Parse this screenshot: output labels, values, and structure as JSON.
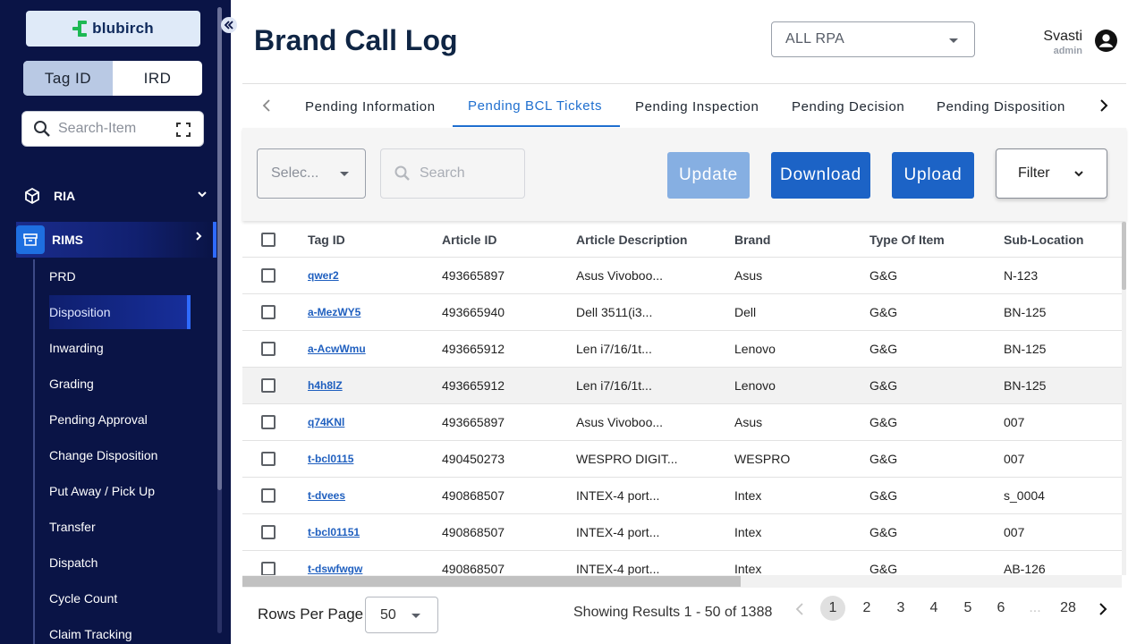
{
  "app": {
    "logo_text": "blubirch"
  },
  "sidebar": {
    "toggle": {
      "left": "Tag ID",
      "right": "IRD"
    },
    "search_placeholder": "Search-Item",
    "modules": [
      {
        "label": "RIA"
      },
      {
        "label": "RIMS"
      }
    ],
    "rims_items": [
      "PRD",
      "Disposition",
      "Inwarding",
      "Grading",
      "Pending Approval",
      "Change Disposition",
      "Put Away / Pick Up",
      "Transfer",
      "Dispatch",
      "Cycle Count",
      "Claim Tracking"
    ],
    "active_item": "Disposition"
  },
  "header": {
    "title": "Brand Call Log",
    "rpa_select": "ALL RPA",
    "user_name": "Svasti",
    "user_role": "admin"
  },
  "tabs": [
    "Pending Information",
    "Pending BCL Tickets",
    "Pending Inspection",
    "Pending Decision",
    "Pending Disposition"
  ],
  "active_tab": "Pending BCL Tickets",
  "toolbar": {
    "select_placeholder": "Selec...",
    "search_placeholder": "Search",
    "update_label": "Update",
    "download_label": "Download",
    "upload_label": "Upload",
    "filter_label": "Filter"
  },
  "table": {
    "columns": [
      "Tag ID",
      "Article ID",
      "Article Description",
      "Brand",
      "Type Of Item",
      "Sub-Location"
    ],
    "rows": [
      [
        "qwer2",
        "493665897",
        "Asus Vivoboo...",
        "Asus",
        "G&G",
        "N-123"
      ],
      [
        "a-MezWY5",
        "493665940",
        "Dell 3511(i3...",
        "Dell",
        "G&G",
        "BN-125"
      ],
      [
        "a-AcwWmu",
        "493665912",
        "Len i7/16/1t...",
        "Lenovo",
        "G&G",
        "BN-125"
      ],
      [
        "h4h8lZ",
        "493665912",
        "Len i7/16/1t...",
        "Lenovo",
        "G&G",
        "BN-125"
      ],
      [
        "q74KNl",
        "493665897",
        "Asus Vivoboo...",
        "Asus",
        "G&G",
        "007"
      ],
      [
        "t-bcl0115",
        "490450273",
        "WESPRO DIGIT...",
        "WESPRO",
        "G&G",
        "007"
      ],
      [
        "t-dvees",
        "490868507",
        "INTEX-4 port...",
        "Intex",
        "G&G",
        "s_0004"
      ],
      [
        "t-bcl01151",
        "490868507",
        "INTEX-4 port...",
        "Intex",
        "G&G",
        "007"
      ],
      [
        "t-dswfwgw",
        "490868507",
        "INTEX-4 port...",
        "Intex",
        "G&G",
        "AB-126"
      ]
    ],
    "highlighted_row": 3
  },
  "footer": {
    "rows_per_page_label": "Rows Per Page",
    "rows_per_page_value": "50",
    "results_text": "Showing Results 1 - 50 of 1388",
    "pages": [
      "1",
      "2",
      "3",
      "4",
      "5",
      "6",
      "...",
      "28"
    ],
    "current_page": "1"
  }
}
